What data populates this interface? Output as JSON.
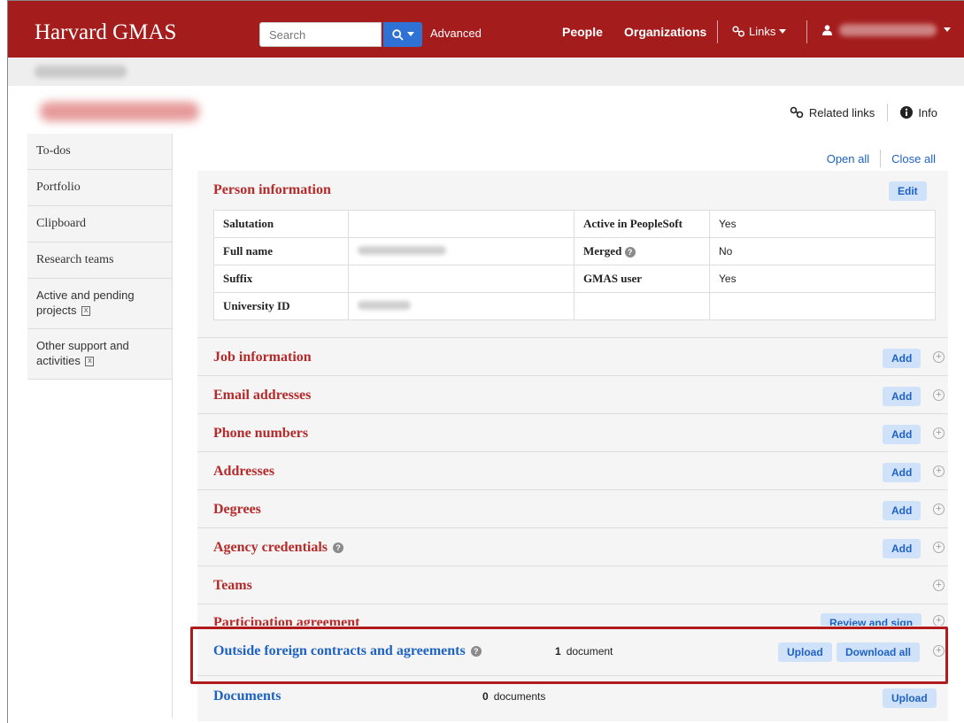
{
  "header": {
    "brand": "Harvard GMAS",
    "search_placeholder": "Search",
    "advanced": "Advanced",
    "nav": [
      "People",
      "Organizations"
    ],
    "links": "Links",
    "accent": "#a51c1c"
  },
  "page": {
    "related_links": "Related links",
    "info": "Info",
    "open_all": "Open all",
    "close_all": "Close all"
  },
  "sidebar": {
    "items": [
      {
        "label": "To-dos"
      },
      {
        "label": "Portfolio"
      },
      {
        "label": "Clipboard"
      },
      {
        "label": "Research teams"
      },
      {
        "label": "Active and pending projects"
      },
      {
        "label": "Other support and activities"
      }
    ]
  },
  "person_info": {
    "title": "Person information",
    "edit": "Edit",
    "rows": [
      {
        "l1": "Salutation",
        "l2": "Active in PeopleSoft",
        "v2": "Yes"
      },
      {
        "l1": "Full name",
        "l2": "Merged",
        "v2": "No"
      },
      {
        "l1": "Suffix",
        "l2": "GMAS user",
        "v2": "Yes"
      },
      {
        "l1": "University ID",
        "l2": "",
        "v2": ""
      }
    ]
  },
  "sections": {
    "job": "Job information",
    "email": "Email addresses",
    "phone": "Phone numbers",
    "addresses": "Addresses",
    "degrees": "Degrees",
    "agency": "Agency credentials",
    "teams": "Teams",
    "participation": "Participation agreement",
    "outside": "Outside foreign contracts and agreements",
    "documents": "Documents"
  },
  "buttons": {
    "add": "Add",
    "review_sign": "Review and sign",
    "upload": "Upload",
    "download_all": "Download all"
  },
  "counts": {
    "outside_num": "1",
    "outside_unit": "document",
    "documents_num": "0",
    "documents_unit": "documents"
  }
}
